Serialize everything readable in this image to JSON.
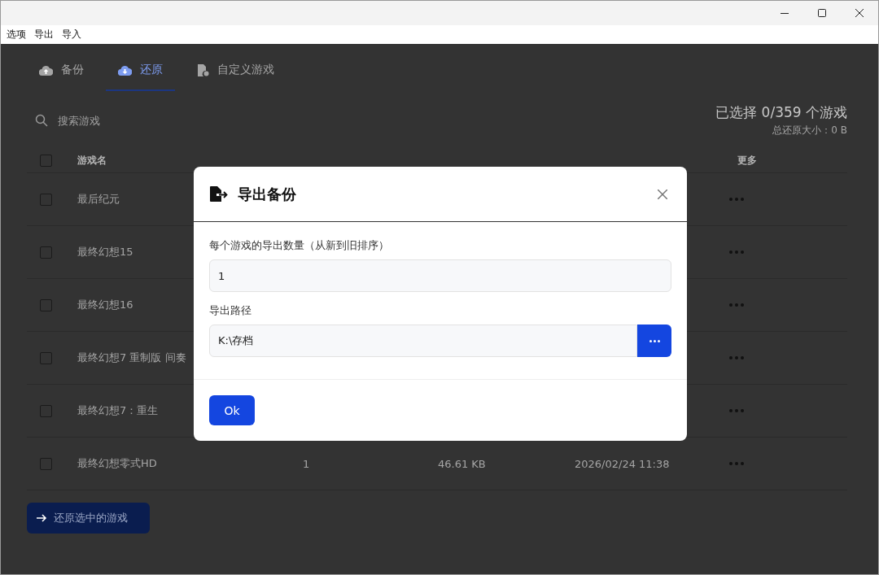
{
  "menu": [
    "选项",
    "导出",
    "导入"
  ],
  "tabs": [
    {
      "label": "备份",
      "kind": "upload",
      "selected": false
    },
    {
      "label": "还原",
      "kind": "download",
      "selected": true
    },
    {
      "label": "自定义游戏",
      "kind": "file",
      "selected": false
    }
  ],
  "search": {
    "placeholder": "搜索游戏"
  },
  "summary": {
    "selected": "已选择 0/359 个游戏",
    "size": "总还原大小：0 B"
  },
  "table": {
    "select_all_checked": false,
    "columns": [
      {
        "label": "游戏名",
        "kind": "name"
      },
      {
        "label": "更多",
        "kind": "more"
      }
    ],
    "rows": [
      {
        "name": "最后纪元",
        "checked": false
      },
      {
        "name": "最终幻想15",
        "checked": false
      },
      {
        "name": "最终幻想16",
        "checked": false
      },
      {
        "name": "最终幻想7 重制版 间奏",
        "checked": false
      },
      {
        "name": "最终幻想7：重生",
        "checked": false
      },
      {
        "name": "最终幻想零式HD",
        "checked": false,
        "count": "1",
        "size": "46.61 KB",
        "date": "2026/02/24 11:38"
      }
    ]
  },
  "restore_button": "还原选中的游戏",
  "dialog": {
    "title": "导出备份",
    "fields": [
      {
        "label": "每个游戏的导出数量（从新到旧排序）",
        "value": "1",
        "kind": "text"
      },
      {
        "label": "导出路径",
        "value": "K:\\存档",
        "kind": "path"
      }
    ],
    "ok": "Ok"
  }
}
